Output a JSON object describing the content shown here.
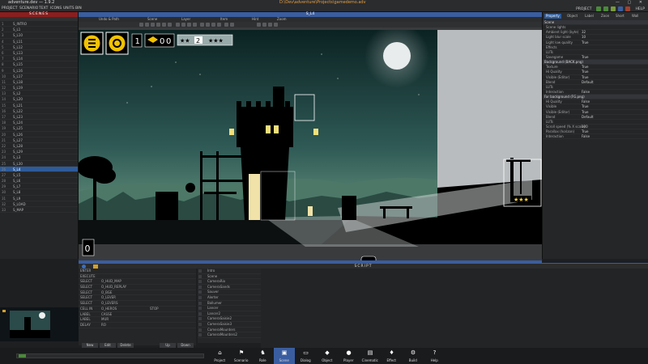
{
  "window": {
    "title": "adventure.dev — 1.9.2",
    "path": "D:\\Dev\\adventure\\Projects\\gamedemo.adv"
  },
  "menu": [
    "PROJECT",
    "SCENARIO",
    "TEXT",
    "ICONS",
    "UNITS",
    "BIN"
  ],
  "mode_label": "PROJECT",
  "help_label": "HELP",
  "scenes": {
    "header": "SCENES",
    "items": [
      {
        "n": "1",
        "label": "S_INTRO"
      },
      {
        "n": "2",
        "label": "S_L1"
      },
      {
        "n": "3",
        "label": "S_L10"
      },
      {
        "n": "4",
        "label": "S_L11"
      },
      {
        "n": "5",
        "label": "S_L12"
      },
      {
        "n": "6",
        "label": "S_L13"
      },
      {
        "n": "7",
        "label": "S_L14"
      },
      {
        "n": "8",
        "label": "S_L15"
      },
      {
        "n": "9",
        "label": "S_L16"
      },
      {
        "n": "10",
        "label": "S_L17"
      },
      {
        "n": "11",
        "label": "S_L18"
      },
      {
        "n": "12",
        "label": "S_L19"
      },
      {
        "n": "13",
        "label": "S_L2"
      },
      {
        "n": "14",
        "label": "S_L20"
      },
      {
        "n": "15",
        "label": "S_L21"
      },
      {
        "n": "16",
        "label": "S_L22"
      },
      {
        "n": "17",
        "label": "S_L23"
      },
      {
        "n": "18",
        "label": "S_L24"
      },
      {
        "n": "19",
        "label": "S_L25"
      },
      {
        "n": "20",
        "label": "S_L26"
      },
      {
        "n": "21",
        "label": "S_L27"
      },
      {
        "n": "22",
        "label": "S_L28"
      },
      {
        "n": "23",
        "label": "S_L29"
      },
      {
        "n": "24",
        "label": "S_L3"
      },
      {
        "n": "25",
        "label": "S_L30"
      },
      {
        "n": "26",
        "label": "S_L4"
      },
      {
        "n": "27",
        "label": "S_L5"
      },
      {
        "n": "28",
        "label": "S_L6"
      },
      {
        "n": "29",
        "label": "S_L7"
      },
      {
        "n": "30",
        "label": "S_L8"
      },
      {
        "n": "31",
        "label": "S_L9"
      },
      {
        "n": "32",
        "label": "S_LOAD"
      },
      {
        "n": "33",
        "label": "S_MAP"
      }
    ],
    "selected_index": 25
  },
  "viewport": {
    "scene_name": "S_L4",
    "tabs": [
      "Undo & Path",
      "Scene",
      "Layer",
      "Item",
      "Hint",
      "Zoom"
    ],
    "hud": {
      "level": "1",
      "counter": "2",
      "token_a": "0",
      "token_b": "0",
      "bottom_token": "0",
      "stars_left": "★★",
      "stars_right": "★★★"
    }
  },
  "properties": {
    "tabs": [
      "Property",
      "Object",
      "Label",
      "Zoon",
      "Short",
      "Wall"
    ],
    "active_tab": "Property",
    "rows": [
      {
        "k": "Scene",
        "v": "",
        "sec": true
      },
      {
        "k": "Scene lights",
        "v": ""
      },
      {
        "k": "Ambient light (byte)",
        "v": "32"
      },
      {
        "k": "Light blur scale",
        "v": "10"
      },
      {
        "k": "Light low quality",
        "v": "True"
      },
      {
        "k": "Effects",
        "v": ""
      },
      {
        "k": "LUTs",
        "v": ""
      },
      {
        "k": "Savegame",
        "v": "True"
      },
      {
        "k": "Background (BACK.png)",
        "v": "",
        "sec": true
      },
      {
        "k": "Texture",
        "v": "True"
      },
      {
        "k": "Hi Quality",
        "v": "True"
      },
      {
        "k": "Visible (Editor)",
        "v": "True"
      },
      {
        "k": "Blend",
        "v": "Default"
      },
      {
        "k": "LUTs",
        "v": ""
      },
      {
        "k": "Interaction",
        "v": "False"
      },
      {
        "k": "Far background (FG.png)",
        "v": "",
        "sec": true
      },
      {
        "k": "Hi Quality",
        "v": "False"
      },
      {
        "k": "Visible",
        "v": "True"
      },
      {
        "k": "Visible (Editor)",
        "v": "True"
      },
      {
        "k": "Blend",
        "v": "Default"
      },
      {
        "k": "LUTs",
        "v": ""
      },
      {
        "k": "Scroll speed (% X scale)",
        "v": "100"
      },
      {
        "k": "Parallax (horizon)",
        "v": "True"
      },
      {
        "k": "Interaction",
        "v": "False"
      }
    ]
  },
  "script": {
    "title": "SCRIPT",
    "commands": [
      {
        "a": "ENTER",
        "b": "",
        "c": ""
      },
      {
        "a": "EXECUTE",
        "b": "",
        "c": ""
      },
      {
        "a": "SELECT",
        "b": "O_HUD_MAP",
        "c": ""
      },
      {
        "a": "SELECT",
        "b": "O_HUD_REPLAY",
        "c": ""
      },
      {
        "a": "SELECT",
        "b": "O_BGE",
        "c": ""
      },
      {
        "a": "SELECT",
        "b": "O_LEVER",
        "c": ""
      },
      {
        "a": "SELECT",
        "b": "O_LEVERS",
        "c": ""
      },
      {
        "a": "CELL IN",
        "b": "O_HEROS",
        "c": "STOP"
      },
      {
        "a": "LABEL",
        "b": "CASSE",
        "c": ""
      },
      {
        "a": "LABEL",
        "b": "MUR",
        "c": ""
      },
      {
        "a": "DELAY",
        "b": "RO",
        "c": ""
      }
    ],
    "buttons": [
      "New",
      "Edit",
      "Delete",
      "Up",
      "Down"
    ],
    "keywords": [
      "Intro",
      "Scene",
      "CameraRio",
      "CameraSands",
      "Sauver",
      "Alerter",
      "Ballumer",
      "Lancer",
      "Lancer2",
      "CameraSaisie2",
      "CameraSaisie3",
      "CameraMounters",
      "CameraMounters2"
    ]
  },
  "nav": [
    {
      "label": "Project",
      "icon": "project-icon",
      "glyph": "⌂"
    },
    {
      "label": "Scenario",
      "icon": "scenario-icon",
      "glyph": "⚑"
    },
    {
      "label": "Role",
      "icon": "role-icon",
      "glyph": "♞"
    },
    {
      "label": "Scene",
      "icon": "scene-icon",
      "glyph": "▣",
      "active": true
    },
    {
      "label": "Dialog",
      "icon": "dialog-icon",
      "glyph": "▭"
    },
    {
      "label": "Object",
      "icon": "object-icon",
      "glyph": "◆"
    },
    {
      "label": "Player",
      "icon": "player-icon",
      "glyph": "●"
    },
    {
      "label": "Cinematic",
      "icon": "cinematic-icon",
      "glyph": "▤"
    },
    {
      "label": "Effect",
      "icon": "effect-icon",
      "glyph": "♦"
    },
    {
      "label": "Build",
      "icon": "build-icon",
      "glyph": "⚙"
    },
    {
      "label": "Help",
      "icon": "help-icon",
      "glyph": "?"
    }
  ],
  "colors": {
    "accent": "#3a5da0",
    "scenes_header": "#8a1e1e",
    "selection": "#2e5b9a"
  }
}
